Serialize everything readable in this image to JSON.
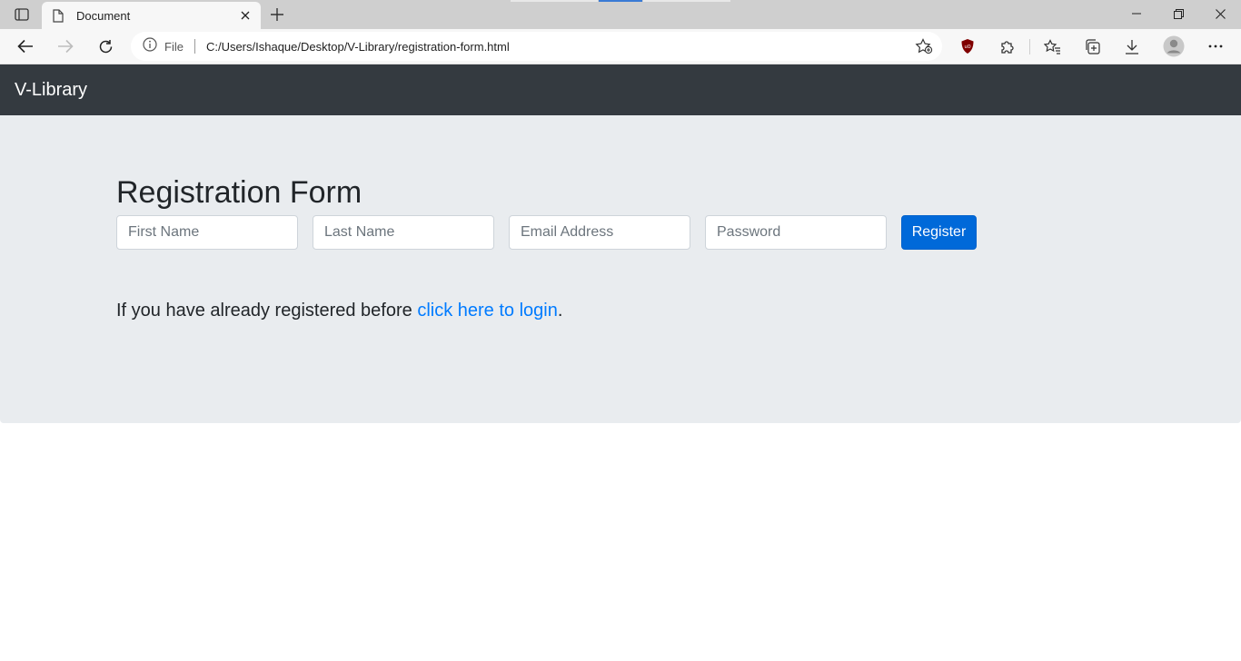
{
  "browser": {
    "tab_title": "Document",
    "address_scheme": "File",
    "url": "C:/Users/Ishaque/Desktop/V-Library/registration-form.html",
    "icons": [
      "tab-actions-icon",
      "page-icon",
      "close-icon",
      "plus-icon",
      "back-icon",
      "forward-icon",
      "refresh-icon",
      "info-icon",
      "favorite-add-icon",
      "ublock-icon",
      "extensions-icon",
      "favorites-icon",
      "collections-icon",
      "download-icon",
      "profile-icon",
      "more-icon",
      "minimize-icon",
      "restore-icon",
      "window-close-icon"
    ]
  },
  "navbar": {
    "brand": "V-Library",
    "background": "#343a40"
  },
  "form": {
    "title": "Registration Form",
    "first_name_placeholder": "First Name",
    "last_name_placeholder": "Last Name",
    "email_placeholder": "Email Address",
    "password_placeholder": "Password",
    "register_label": "Register"
  },
  "login_note": {
    "prefix": "If you have already registered before ",
    "link_text": "click here to login",
    "suffix": "."
  },
  "colors": {
    "accent": "#0069d9",
    "link": "#007bff",
    "jumbotron": "#e9ecef"
  }
}
